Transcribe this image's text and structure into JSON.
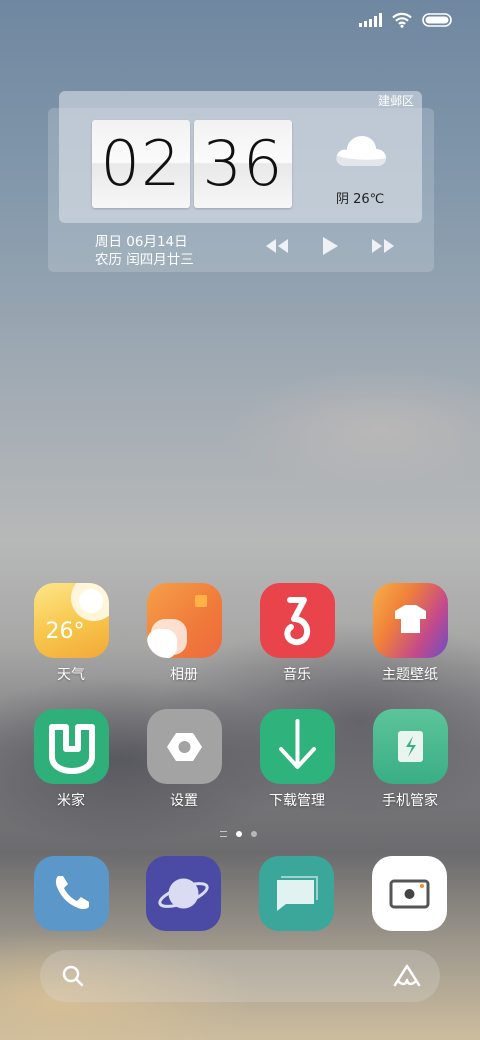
{
  "status_bar": {
    "signal_icon": "signal-icon",
    "wifi_icon": "wifi-icon",
    "battery_icon": "battery-icon"
  },
  "clock_widget": {
    "district": "建邺区",
    "hour": "02",
    "minute": "36",
    "weather_icon": "cloud-icon",
    "weather": "阴  26℃",
    "date": "周日 06月14日",
    "lunar_date": "农历 闰四月廿三",
    "media_controls": [
      "previous-icon",
      "play-icon",
      "next-icon"
    ]
  },
  "apps": [
    {
      "label": "天气",
      "icon": "weather-app-icon",
      "icon_text": "26°"
    },
    {
      "label": "相册",
      "icon": "gallery-app-icon"
    },
    {
      "label": "音乐",
      "icon": "music-app-icon"
    },
    {
      "label": "主题壁纸",
      "icon": "themes-app-icon"
    },
    {
      "label": "米家",
      "icon": "mijia-app-icon"
    },
    {
      "label": "设置",
      "icon": "settings-app-icon"
    },
    {
      "label": "下载管理",
      "icon": "downloads-app-icon"
    },
    {
      "label": "手机管家",
      "icon": "security-app-icon"
    }
  ],
  "page_indicator": {
    "pages": 2,
    "current": 1
  },
  "dock": [
    {
      "icon": "phone-icon"
    },
    {
      "icon": "browser-icon"
    },
    {
      "icon": "messages-icon"
    },
    {
      "icon": "camera-icon"
    }
  ],
  "search_bar": {
    "search_icon": "search-icon",
    "assistant_icon": "assistant-icon"
  },
  "colors": {
    "weather": "#f7c64a",
    "gallery": "#f28a3a",
    "music": "#e9434c",
    "themes": "#f08a3c",
    "mijia": "#2fb07a",
    "settings": "#9a9a9a",
    "downloads": "#2db37b",
    "security": "#3aae85",
    "phone": "#4f8fc9",
    "browser": "#4b4aa4",
    "messages": "#3aa79a",
    "camera": "#ffffff"
  }
}
